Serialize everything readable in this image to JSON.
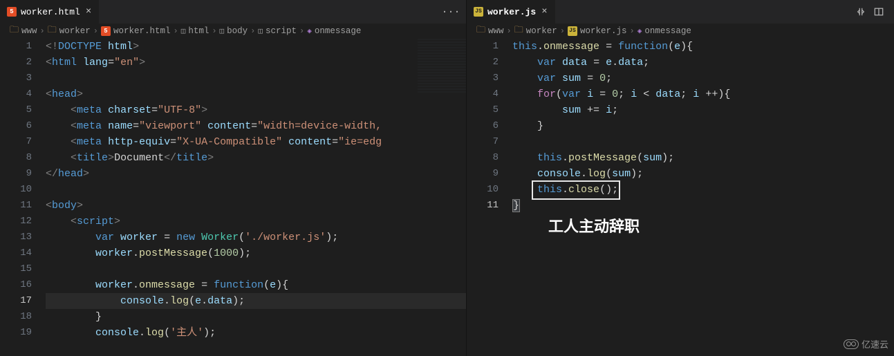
{
  "left": {
    "tab": {
      "name": "worker.html",
      "close": "×"
    },
    "actions": {
      "more": "···"
    },
    "breadcrumbs": [
      "www",
      "worker",
      "worker.html",
      "html",
      "body",
      "script",
      "onmessage"
    ],
    "currentLine": 17,
    "lines": [
      "<!DOCTYPE html>",
      "<html lang=\"en\">",
      "",
      "<head>",
      "    <meta charset=\"UTF-8\">",
      "    <meta name=\"viewport\" content=\"width=device-width,",
      "    <meta http-equiv=\"X-UA-Compatible\" content=\"ie=edg",
      "    <title>Document</title>",
      "</head>",
      "",
      "<body>",
      "    <script>",
      "        var worker = new Worker('./worker.js');",
      "        worker.postMessage(1000);",
      "",
      "        worker.onmessage = function(e){",
      "            console.log(e.data);",
      "        }",
      "        console.log('主人');"
    ]
  },
  "right": {
    "tab": {
      "name": "worker.js",
      "close": "×"
    },
    "breadcrumbs": [
      "www",
      "worker",
      "worker.js",
      "onmessage"
    ],
    "currentLine": 11,
    "lines": [
      "this.onmessage = function(e){",
      "    var data = e.data;",
      "    var sum = 0;",
      "    for(var i = 0; i < data; i ++){",
      "        sum += i;",
      "    }",
      "",
      "    this.postMessage(sum);",
      "    console.log(sum);",
      "    this.close();",
      "}"
    ],
    "annotation": "工人主动辞职"
  },
  "watermark": "亿速云"
}
